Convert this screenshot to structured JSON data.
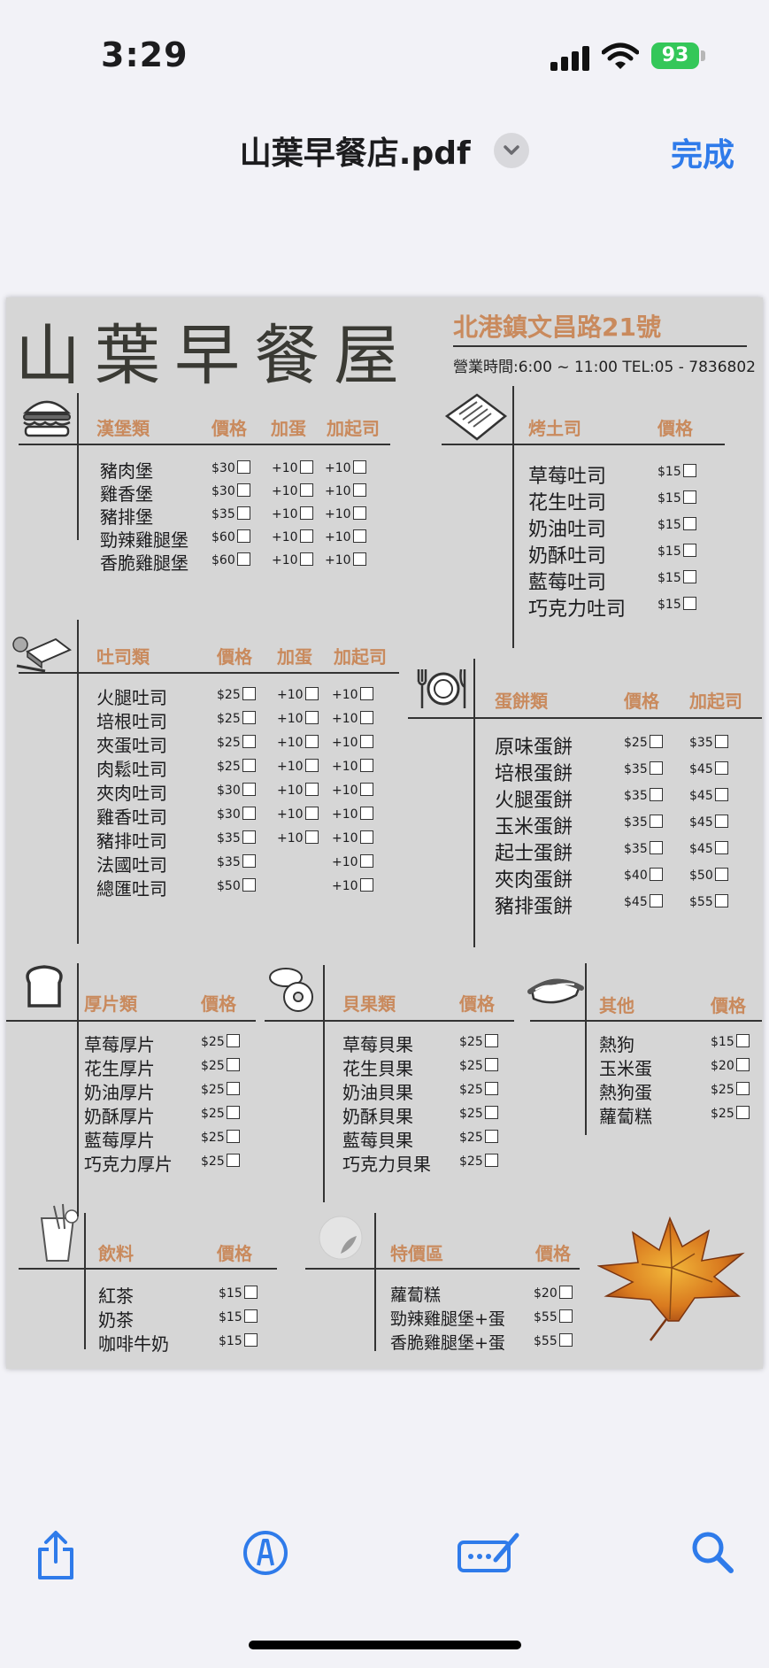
{
  "status": {
    "time": "3:29",
    "battery": "93"
  },
  "nav": {
    "title": "山葉早餐店.pdf",
    "done": "完成"
  },
  "menu": {
    "name": "山葉早餐屋",
    "address": "北港鎮文昌路21號",
    "hours": "營業時間:6:00 ~ 11:00  TEL:05 - 7836802",
    "burger": {
      "headers": [
        "漢堡類",
        "價格",
        "加蛋",
        "加起司"
      ],
      "items": [
        {
          "name": "豬肉堡",
          "price": "$30",
          "egg": "+10",
          "cheese": "+10"
        },
        {
          "name": "雞香堡",
          "price": "$30",
          "egg": "+10",
          "cheese": "+10"
        },
        {
          "name": "豬排堡",
          "price": "$35",
          "egg": "+10",
          "cheese": "+10"
        },
        {
          "name": "勁辣雞腿堡",
          "price": "$60",
          "egg": "+10",
          "cheese": "+10"
        },
        {
          "name": "香脆雞腿堡",
          "price": "$60",
          "egg": "+10",
          "cheese": "+10"
        }
      ]
    },
    "toast": {
      "headers": [
        "烤土司",
        "價格"
      ],
      "items": [
        {
          "name": "草莓吐司",
          "price": "$15"
        },
        {
          "name": "花生吐司",
          "price": "$15"
        },
        {
          "name": "奶油吐司",
          "price": "$15"
        },
        {
          "name": "奶酥吐司",
          "price": "$15"
        },
        {
          "name": "藍莓吐司",
          "price": "$15"
        },
        {
          "name": "巧克力吐司",
          "price": "$15"
        }
      ]
    },
    "sandwich": {
      "headers": [
        "吐司類",
        "價格",
        "加蛋",
        "加起司"
      ],
      "items": [
        {
          "name": "火腿吐司",
          "price": "$25",
          "egg": "+10",
          "cheese": "+10"
        },
        {
          "name": "培根吐司",
          "price": "$25",
          "egg": "+10",
          "cheese": "+10"
        },
        {
          "name": "夾蛋吐司",
          "price": "$25",
          "egg": "+10",
          "cheese": "+10"
        },
        {
          "name": "肉鬆吐司",
          "price": "$25",
          "egg": "+10",
          "cheese": "+10"
        },
        {
          "name": "夾肉吐司",
          "price": "$30",
          "egg": "+10",
          "cheese": "+10"
        },
        {
          "name": "雞香吐司",
          "price": "$30",
          "egg": "+10",
          "cheese": "+10"
        },
        {
          "name": "豬排吐司",
          "price": "$35",
          "egg": "+10",
          "cheese": "+10"
        },
        {
          "name": "法國吐司",
          "price": "$35",
          "egg": "",
          "cheese": "+10"
        },
        {
          "name": "總匯吐司",
          "price": "$50",
          "egg": "",
          "cheese": "+10"
        }
      ]
    },
    "eggroll": {
      "headers": [
        "蛋餅類",
        "價格",
        "加起司"
      ],
      "items": [
        {
          "name": "原味蛋餅",
          "price": "$25",
          "cheese": "$35"
        },
        {
          "name": "培根蛋餅",
          "price": "$35",
          "cheese": "$45"
        },
        {
          "name": "火腿蛋餅",
          "price": "$35",
          "cheese": "$45"
        },
        {
          "name": "玉米蛋餅",
          "price": "$35",
          "cheese": "$45"
        },
        {
          "name": "起士蛋餅",
          "price": "$35",
          "cheese": "$45"
        },
        {
          "name": "夾肉蛋餅",
          "price": "$40",
          "cheese": "$50"
        },
        {
          "name": "豬排蛋餅",
          "price": "$45",
          "cheese": "$55"
        }
      ]
    },
    "thick": {
      "headers": [
        "厚片類",
        "價格"
      ],
      "items": [
        {
          "name": "草莓厚片",
          "price": "$25"
        },
        {
          "name": "花生厚片",
          "price": "$25"
        },
        {
          "name": "奶油厚片",
          "price": "$25"
        },
        {
          "name": "奶酥厚片",
          "price": "$25"
        },
        {
          "name": "藍莓厚片",
          "price": "$25"
        },
        {
          "name": "巧克力厚片",
          "price": "$25"
        }
      ]
    },
    "bagel": {
      "headers": [
        "貝果類",
        "價格"
      ],
      "items": [
        {
          "name": "草莓貝果",
          "price": "$25"
        },
        {
          "name": "花生貝果",
          "price": "$25"
        },
        {
          "name": "奶油貝果",
          "price": "$25"
        },
        {
          "name": "奶酥貝果",
          "price": "$25"
        },
        {
          "name": "藍莓貝果",
          "price": "$25"
        },
        {
          "name": "巧克力貝果",
          "price": "$25"
        }
      ]
    },
    "other": {
      "headers": [
        "其他",
        "價格"
      ],
      "items": [
        {
          "name": "熱狗",
          "price": "$15"
        },
        {
          "name": "玉米蛋",
          "price": "$20"
        },
        {
          "name": "熱狗蛋",
          "price": "$25"
        },
        {
          "name": "蘿蔔糕",
          "price": "$25"
        }
      ]
    },
    "drinks": {
      "headers": [
        "飲料",
        "價格"
      ],
      "items": [
        {
          "name": "紅茶",
          "price": "$15"
        },
        {
          "name": "奶茶",
          "price": "$15"
        },
        {
          "name": "咖啡牛奶",
          "price": "$15"
        }
      ]
    },
    "special": {
      "headers": [
        "特價區",
        "價格"
      ],
      "items": [
        {
          "name": "蘿蔔糕",
          "price": "$20"
        },
        {
          "name": "勁辣雞腿堡+蛋",
          "price": "$55"
        },
        {
          "name": "香脆雞腿堡+蛋",
          "price": "$55"
        }
      ]
    }
  },
  "toolbar": {
    "icons": [
      "share-icon",
      "markup-icon",
      "form-fill-icon",
      "search-icon"
    ]
  },
  "colors": {
    "accent": "#2f7bea",
    "menu_heading": "#c98a5d",
    "page": "#d6d6d6",
    "battery": "#34c759"
  }
}
